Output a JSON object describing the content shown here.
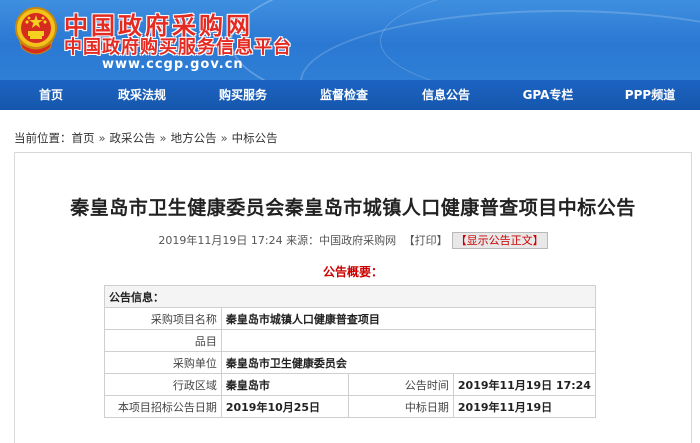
{
  "header": {
    "title": "中国政府采购网",
    "subtitle": "中国政府购买服务信息平台",
    "url": "www.ccgp.gov.cn",
    "emblem_icon": "national-emblem-icon"
  },
  "nav": {
    "items": [
      {
        "label": "首页"
      },
      {
        "label": "政采法规"
      },
      {
        "label": "购买服务"
      },
      {
        "label": "监督检查"
      },
      {
        "label": "信息公告"
      },
      {
        "label": "GPA专栏"
      },
      {
        "label": "PPP频道"
      }
    ]
  },
  "breadcrumb": {
    "prefix": "当前位置：",
    "items": [
      "首页",
      "政采公告",
      "地方公告",
      "中标公告"
    ],
    "separator": "»"
  },
  "article": {
    "title": "秦皇岛市卫生健康委员会秦皇岛市城镇人口健康普查项目中标公告",
    "date": "2019年11月19日 17:24",
    "source": "来源：中国政府采购网",
    "print_label": "【打印】",
    "show_label": "【显示公告正文】",
    "summary_label": "公告概要："
  },
  "info": {
    "header": "公告信息：",
    "project_name_label": "采购项目名称",
    "project_name": "秦皇岛市城镇人口健康普查项目",
    "item_label": "品目",
    "item": "",
    "buyer_label": "采购单位",
    "buyer": "秦皇岛市卫生健康委员会",
    "region_label": "行政区域",
    "region": "秦皇岛市",
    "publish_time_label": "公告时间",
    "publish_time": "2019年11月19日 17:24",
    "bid_date_label": "本项目招标公告日期",
    "bid_date": "2019年10月25日",
    "award_date_label": "中标日期",
    "award_date": "2019年11月19日"
  },
  "colors": {
    "banner_blue": "#2a78d2",
    "nav_blue": "#1657ad",
    "title_red": "#e52a22",
    "accent_red": "#cc0000"
  }
}
